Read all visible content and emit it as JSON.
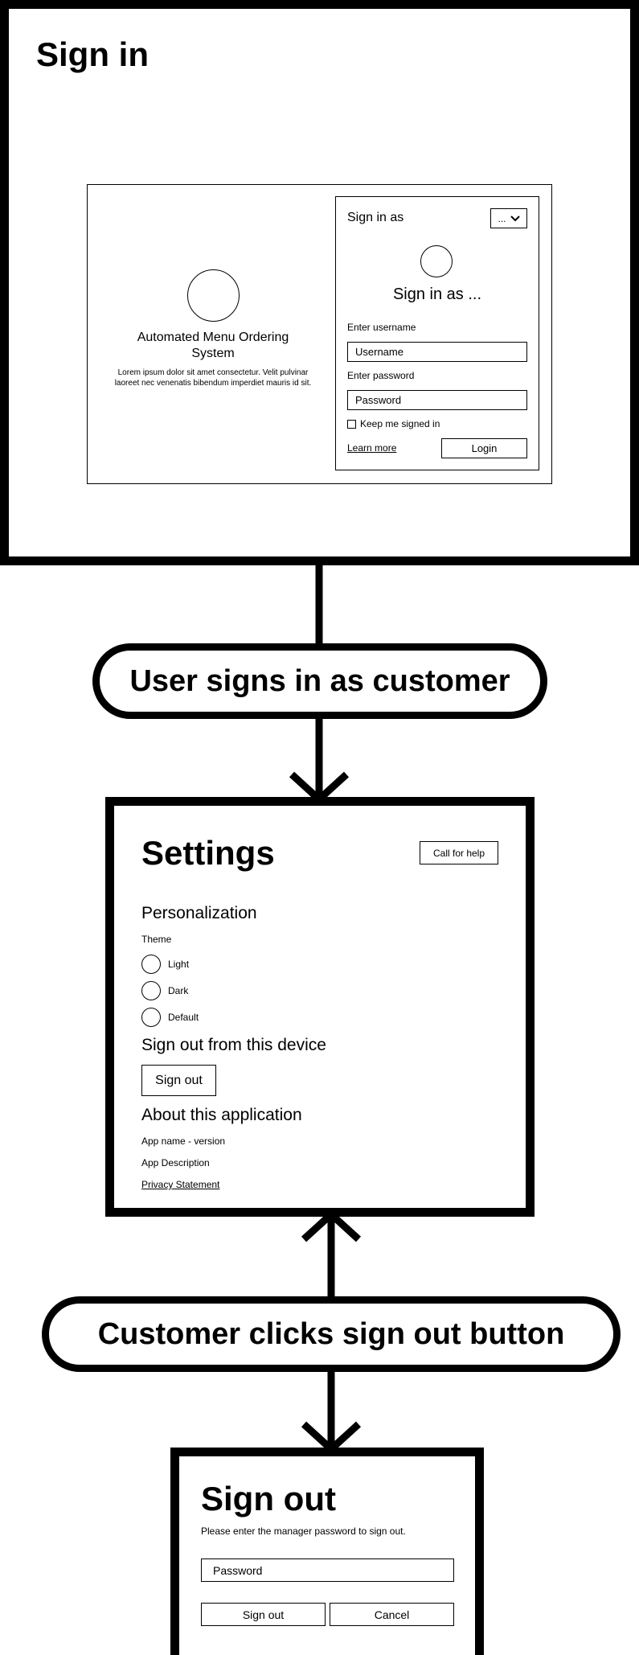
{
  "signin_screen": {
    "heading": "Sign in",
    "app_title": "Automated Menu Ordering System",
    "app_description": "Lorem ipsum dolor sit amet consectetur. Velit pulvinar laoreet nec venenatis bibendum imperdiet mauris id sit.",
    "panel_label": "Sign in as",
    "dropdown_value": "...",
    "panel_heading": "Sign in as ...",
    "username_label": "Enter username",
    "username_placeholder": "Username",
    "password_label": "Enter password",
    "password_placeholder": "Password",
    "keep_signed_in": "Keep me signed in",
    "learn_more": "Learn more",
    "login_button": "Login"
  },
  "step1_label": "User signs in as customer",
  "settings_screen": {
    "heading": "Settings",
    "help_button": "Call for help",
    "personalization_heading": "Personalization",
    "theme_label": "Theme",
    "theme_options": [
      "Light",
      "Dark",
      "Default"
    ],
    "signout_heading": "Sign out from this device",
    "signout_button": "Sign out",
    "about_heading": "About this application",
    "app_name_version": "App name - version",
    "app_description": "App Description",
    "privacy_link": "Privacy Statement"
  },
  "step2_label": "Customer clicks sign out button",
  "signout_screen": {
    "heading": "Sign out",
    "instruction": "Please enter the manager password to sign out.",
    "password_placeholder": "Password",
    "signout_button": "Sign out",
    "cancel_button": "Cancel"
  }
}
